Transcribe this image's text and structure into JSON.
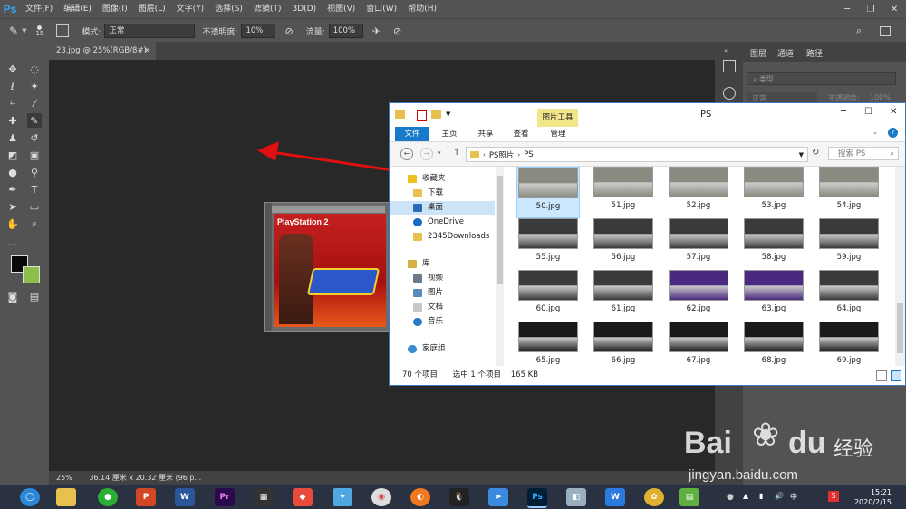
{
  "app": {
    "logo": "Ps",
    "menu": [
      "文件(F)",
      "编辑(E)",
      "图像(I)",
      "图层(L)",
      "文字(Y)",
      "选择(S)",
      "滤镜(T)",
      "3D(D)",
      "视图(V)",
      "窗口(W)",
      "帮助(H)"
    ]
  },
  "options": {
    "brush_size": "15",
    "mode_label": "模式:",
    "mode_value": "正常",
    "opacity_label": "不透明度:",
    "opacity_value": "10%",
    "flow_label": "流量:",
    "flow_value": "100%"
  },
  "document": {
    "tab_title": "23.jpg @ 25%(RGB/8#)",
    "close": "×",
    "status_zoom": "25%",
    "status_size": "36.14 厘米 x 20.32 厘米 (96 p...",
    "thumb_title": "PlayStation 2"
  },
  "panels": {
    "tabs": [
      "图层",
      "通道",
      "路径"
    ],
    "filter_placeholder": "类型",
    "blend_mode": "正常",
    "opacity_label": "不透明度:",
    "opacity_value": "100%"
  },
  "explorer": {
    "title": "PS",
    "tool_tab": "图片工具",
    "ribbon_tabs": [
      "文件",
      "主页",
      "共享",
      "查看",
      "管理"
    ],
    "breadcrumb": [
      "PS照片",
      "PS"
    ],
    "search_placeholder": "搜索 PS",
    "nav": {
      "favorites": "收藏夹",
      "downloads": "下载",
      "desktop": "桌面",
      "onedrive": "OneDrive",
      "downloads2345": "2345Downloads",
      "library": "库",
      "videos": "视频",
      "pictures": "图片",
      "documents": "文档",
      "music": "音乐",
      "homegroup": "家庭组"
    },
    "files": [
      "50.jpg",
      "51.jpg",
      "52.jpg",
      "53.jpg",
      "54.jpg",
      "55.jpg",
      "56.jpg",
      "57.jpg",
      "58.jpg",
      "59.jpg",
      "60.jpg",
      "61.jpg",
      "62.jpg",
      "63.jpg",
      "64.jpg",
      "65.jpg",
      "66.jpg",
      "67.jpg",
      "68.jpg",
      "69.jpg"
    ],
    "selected_file": "50.jpg",
    "status_count": "70 个项目",
    "status_selected": "选中 1 个项目",
    "status_size": "165 KB"
  },
  "taskbar": {
    "clock_time": "15:21",
    "clock_date": "2020/2/15"
  },
  "watermark": {
    "brand": "Bai",
    "brand2": "du",
    "cn": "经验",
    "url": "jingyan.baidu.com"
  },
  "colors": {
    "accent_blue": "#1979ca",
    "arrow_red": "#e01010",
    "ps_blue": "#31a8ff",
    "tool_tab_yellow": "#f3e58a"
  }
}
